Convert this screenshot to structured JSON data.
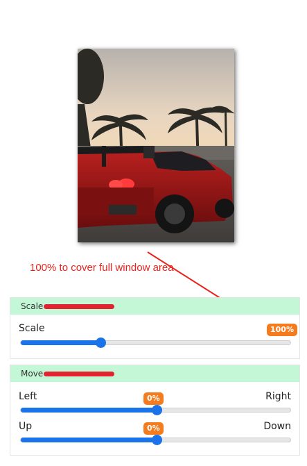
{
  "preview": {
    "alt": "red sports car photo"
  },
  "annotation": {
    "text": "100% to cover full window area"
  },
  "scale_panel": {
    "title": "Scale",
    "label": "Scale",
    "value_text": "100%",
    "value": 100,
    "fill_fraction": 0.3
  },
  "move_panel": {
    "title": "Move",
    "horizontal": {
      "left_label": "Left",
      "right_label": "Right",
      "value_text": "0%",
      "fill_fraction": 0.5
    },
    "vertical": {
      "up_label": "Up",
      "down_label": "Down",
      "value_text": "0%",
      "fill_fraction": 0.5
    }
  },
  "colors": {
    "accent": "#1a73e8",
    "badge": "#f47c1f",
    "panel_header": "#c3f7d6",
    "annotation": "#e8231d"
  }
}
